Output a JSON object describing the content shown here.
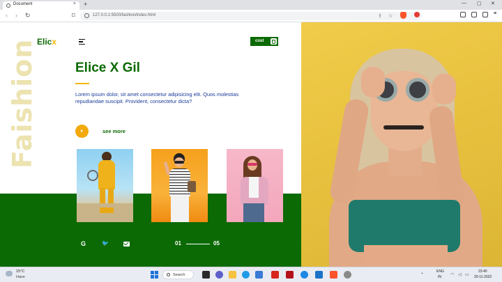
{
  "browser": {
    "tab_title": "Document",
    "tab_close": "×",
    "new_tab": "+",
    "minimize": "—",
    "maximize": "▢",
    "close": "✕",
    "back": "‹",
    "forward": "›",
    "reload": "↻",
    "bookmark": "⌑",
    "url": "127.0.0.1:5500/fashion/index.html",
    "share": "⇪",
    "star": "☆"
  },
  "site": {
    "logo_main": "Elic",
    "logo_accent": "x",
    "cost_label": "cost",
    "vertical_word": "Faishion",
    "hero_title": "Elice X Gil",
    "hero_text": "Lorem ipsum dolor, sit amet consectetur adipisicing elit. Quos molestias repudiandae suscipit. Provident, consectetur dicta?",
    "see_more": "see more",
    "social": {
      "google": "G",
      "twitter": "🐦"
    },
    "slide_start": "01",
    "slide_end": "05"
  },
  "colors": {
    "brand_green": "#0c6a04",
    "accent_yellow": "#f2b705",
    "photo_bg_yellow": "#e8c23f"
  },
  "taskbar": {
    "temperature": "15°C",
    "condition": "Haze",
    "search_label": "Search",
    "language": "ENG",
    "region": "IN",
    "time": "23:40",
    "date": "20-11-2022"
  }
}
